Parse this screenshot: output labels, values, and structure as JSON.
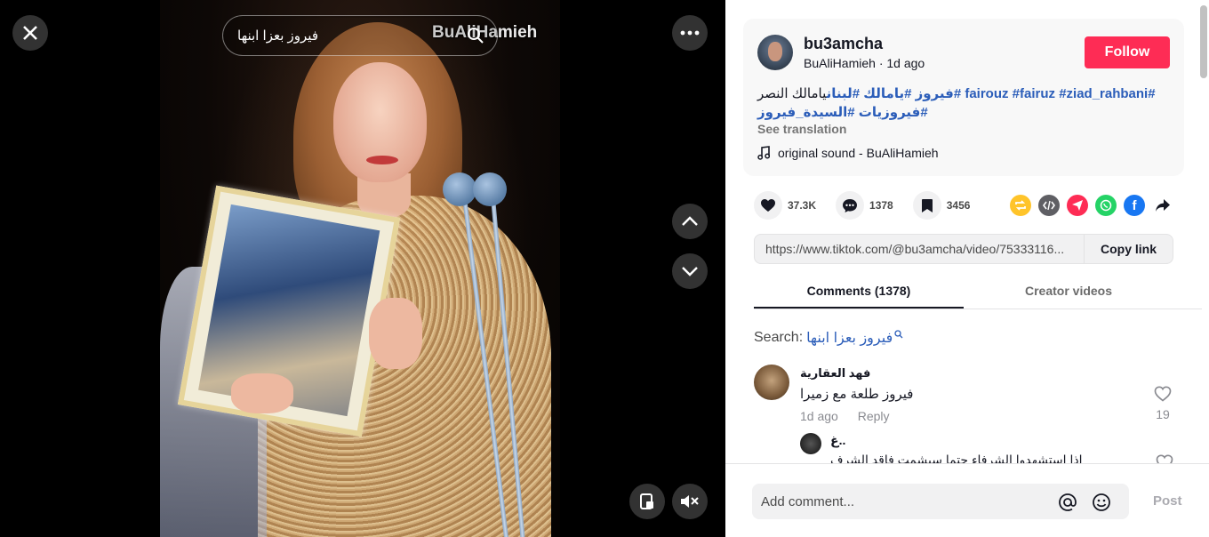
{
  "video": {
    "search_text": "فيروز بعزا ابنها",
    "watermark": "BuAliHamieh"
  },
  "author": {
    "username": "bu3amcha",
    "display_name": "BuAliHamieh",
    "time": "1d ago",
    "follow_label": "Follow"
  },
  "description": {
    "line1_plain": "يامالك النصر",
    "line1_tags": "#fairouz #fairuz #ziad_rahbani #فيروز #يامالك #لبنان",
    "line2_tags": "#فيروزيات #السيدة_فيروز",
    "see_translation": "See translation",
    "sound": "original sound - BuAliHamieh"
  },
  "actions": {
    "likes": "37.3K",
    "comments": "1378",
    "saves": "3456"
  },
  "share": {
    "link": "https://www.tiktok.com/@bu3amcha/video/75333116...",
    "copy_label": "Copy link"
  },
  "tabs": [
    {
      "label": "Comments (1378)"
    },
    {
      "label": "Creator videos"
    }
  ],
  "search": {
    "label": "Search:",
    "term": "فيروز بعزا ابنها"
  },
  "comments": [
    {
      "user": "فهد العقارية",
      "text": "فيروز طلعة مع زميرا",
      "time": "1d ago",
      "reply_label": "Reply",
      "likes": "19"
    }
  ],
  "reply": {
    "user": "غ..",
    "text": "اذا استشهدوا الشرفاء حتما سيشمت فاقد الشرف"
  },
  "comment_box": {
    "placeholder": "Add comment...",
    "post_label": "Post"
  },
  "colors": {
    "accent": "#fe2c55",
    "hashtag": "#2b5db9"
  }
}
